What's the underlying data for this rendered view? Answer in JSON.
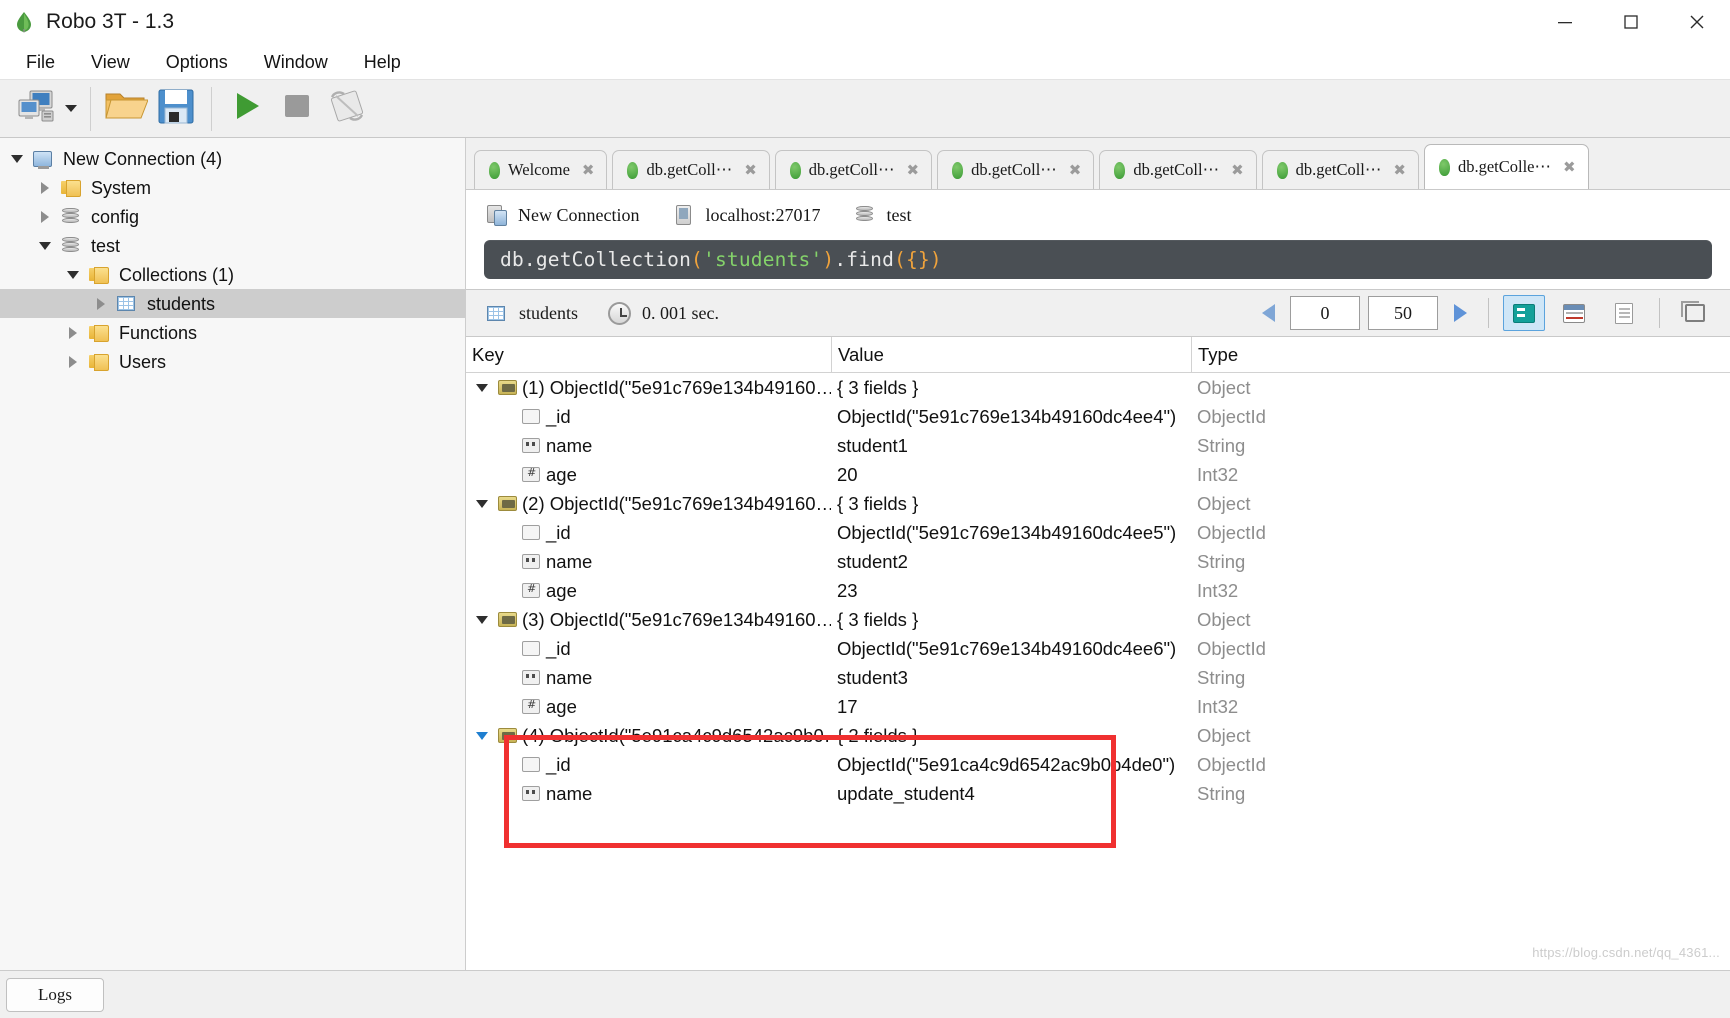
{
  "window": {
    "title": "Robo 3T - 1.3",
    "app_icon": "mongodb-leaf-icon",
    "controls": {
      "minimize": "minimize-icon",
      "maximize": "maximize-icon",
      "close": "close-icon"
    }
  },
  "menubar": {
    "items": [
      {
        "label": "File"
      },
      {
        "label": "View"
      },
      {
        "label": "Options"
      },
      {
        "label": "Window"
      },
      {
        "label": "Help"
      }
    ]
  },
  "toolbar": {
    "buttons": [
      {
        "name": "connect-button",
        "icon": "computer-connect-icon"
      },
      {
        "name": "connect-dropdown",
        "icon": "chevron-down-icon"
      },
      {
        "name": "open-script-button",
        "icon": "folder-open-icon"
      },
      {
        "name": "save-script-button",
        "icon": "floppy-save-icon"
      },
      {
        "name": "execute-button",
        "icon": "play-icon"
      },
      {
        "name": "stop-button",
        "icon": "stop-square-icon"
      },
      {
        "name": "orientation-button",
        "icon": "rotate-layout-icon"
      }
    ]
  },
  "sidebar": {
    "items": [
      {
        "label": "New Connection (4)",
        "icon": "server-monitor-icon",
        "expanded": true,
        "indent": 0,
        "selected": false
      },
      {
        "label": "System",
        "icon": "folder-icon",
        "expanded": false,
        "indent": 1,
        "selected": false
      },
      {
        "label": "config",
        "icon": "database-icon",
        "expanded": false,
        "indent": 1,
        "selected": false
      },
      {
        "label": "test",
        "icon": "database-icon",
        "expanded": true,
        "indent": 1,
        "selected": false
      },
      {
        "label": "Collections (1)",
        "icon": "folder-icon",
        "expanded": true,
        "indent": 2,
        "selected": false
      },
      {
        "label": "students",
        "icon": "collection-grid-icon",
        "expanded": false,
        "indent": 3,
        "selected": true
      },
      {
        "label": "Functions",
        "icon": "folder-icon",
        "expanded": false,
        "indent": 2,
        "selected": false
      },
      {
        "label": "Users",
        "icon": "folder-icon",
        "expanded": false,
        "indent": 2,
        "selected": false
      }
    ]
  },
  "tabs": [
    {
      "label": "Welcome",
      "icon": "mongodb-leaf-icon",
      "close": "✖",
      "active": false
    },
    {
      "label": "db.getColl⋯",
      "icon": "mongodb-leaf-icon",
      "close": "✖",
      "active": false
    },
    {
      "label": "db.getColl⋯",
      "icon": "mongodb-leaf-icon",
      "close": "✖",
      "active": false
    },
    {
      "label": "db.getColl⋯",
      "icon": "mongodb-leaf-icon",
      "close": "✖",
      "active": false
    },
    {
      "label": "db.getColl⋯",
      "icon": "mongodb-leaf-icon",
      "close": "✖",
      "active": false
    },
    {
      "label": "db.getColl⋯",
      "icon": "mongodb-leaf-icon",
      "close": "✖",
      "active": false
    },
    {
      "label": "db.getColle⋯",
      "icon": "mongodb-leaf-icon",
      "close": "✖",
      "active": true
    }
  ],
  "connection_info": {
    "connection_name": "New Connection",
    "host": "localhost:27017",
    "database": "test"
  },
  "editor": {
    "tokens": [
      {
        "text": "db.getCollection",
        "type": "plain"
      },
      {
        "text": "(",
        "type": "punct"
      },
      {
        "text": "'students'",
        "type": "string"
      },
      {
        "text": ")",
        "type": "punct"
      },
      {
        "text": ".find",
        "type": "plain"
      },
      {
        "text": "(",
        "type": "punct"
      },
      {
        "text": "{",
        "type": "punct"
      },
      {
        "text": "}",
        "type": "punct"
      },
      {
        "text": ")",
        "type": "punct"
      }
    ],
    "full_text": "db.getCollection('students').find({})"
  },
  "results_toolbar": {
    "collection": "students",
    "collection_icon": "collection-grid-icon",
    "time_icon": "clock-icon",
    "elapsed": "0. 001 sec.",
    "prev_icon": "arrow-left-icon",
    "skip_value": "0",
    "limit_value": "50",
    "next_icon": "arrow-right-icon",
    "view_modes": [
      {
        "name": "tree-view-button",
        "icon": "tree-view-icon",
        "active": true
      },
      {
        "name": "table-view-button",
        "icon": "table-view-icon",
        "active": false
      },
      {
        "name": "text-view-button",
        "icon": "text-view-icon",
        "active": false
      },
      {
        "name": "detach-view-button",
        "icon": "copy-window-icon",
        "active": false
      }
    ]
  },
  "results": {
    "columns": [
      "Key",
      "Value",
      "Type"
    ],
    "rows": [
      {
        "indent": 0,
        "twisty": "down",
        "icon": "object-icon",
        "key": "(1) ObjectId(\"5e91c769e134b49160…",
        "value": "{ 3 fields }",
        "type": "Object"
      },
      {
        "indent": 1,
        "twisty": "none",
        "icon": "objectid-icon",
        "key": "_id",
        "value": "ObjectId(\"5e91c769e134b49160dc4ee4\")",
        "type": "ObjectId"
      },
      {
        "indent": 1,
        "twisty": "none",
        "icon": "string-icon",
        "key": "name",
        "value": "student1",
        "type": "String"
      },
      {
        "indent": 1,
        "twisty": "none",
        "icon": "int-icon",
        "key": "age",
        "value": "20",
        "type": "Int32"
      },
      {
        "indent": 0,
        "twisty": "down",
        "icon": "object-icon",
        "key": "(2) ObjectId(\"5e91c769e134b49160…",
        "value": "{ 3 fields }",
        "type": "Object"
      },
      {
        "indent": 1,
        "twisty": "none",
        "icon": "objectid-icon",
        "key": "_id",
        "value": "ObjectId(\"5e91c769e134b49160dc4ee5\")",
        "type": "ObjectId"
      },
      {
        "indent": 1,
        "twisty": "none",
        "icon": "string-icon",
        "key": "name",
        "value": "student2",
        "type": "String"
      },
      {
        "indent": 1,
        "twisty": "none",
        "icon": "int-icon",
        "key": "age",
        "value": "23",
        "type": "Int32"
      },
      {
        "indent": 0,
        "twisty": "down",
        "icon": "object-icon",
        "key": "(3) ObjectId(\"5e91c769e134b49160…",
        "value": "{ 3 fields }",
        "type": "Object"
      },
      {
        "indent": 1,
        "twisty": "none",
        "icon": "objectid-icon",
        "key": "_id",
        "value": "ObjectId(\"5e91c769e134b49160dc4ee6\")",
        "type": "ObjectId"
      },
      {
        "indent": 1,
        "twisty": "none",
        "icon": "string-icon",
        "key": "name",
        "value": "student3",
        "type": "String"
      },
      {
        "indent": 1,
        "twisty": "none",
        "icon": "int-icon",
        "key": "age",
        "value": "17",
        "type": "Int32"
      },
      {
        "indent": 0,
        "twisty": "down-blue",
        "icon": "object-icon",
        "key": "(4) ObjectId(\"5e91ca4c9d6542ac9b0…",
        "value": "{ 2 fields }",
        "type": "Object"
      },
      {
        "indent": 1,
        "twisty": "none",
        "icon": "objectid-icon",
        "key": "_id",
        "value": "ObjectId(\"5e91ca4c9d6542ac9b0b4de0\")",
        "type": "ObjectId"
      },
      {
        "indent": 1,
        "twisty": "none",
        "icon": "string-icon",
        "key": "name",
        "value": "update_student4",
        "type": "String"
      }
    ],
    "highlight_color": "#f03030"
  },
  "statusbar": {
    "logs_label": "Logs",
    "watermark": "https://blog.csdn.net/qq_4361..."
  }
}
